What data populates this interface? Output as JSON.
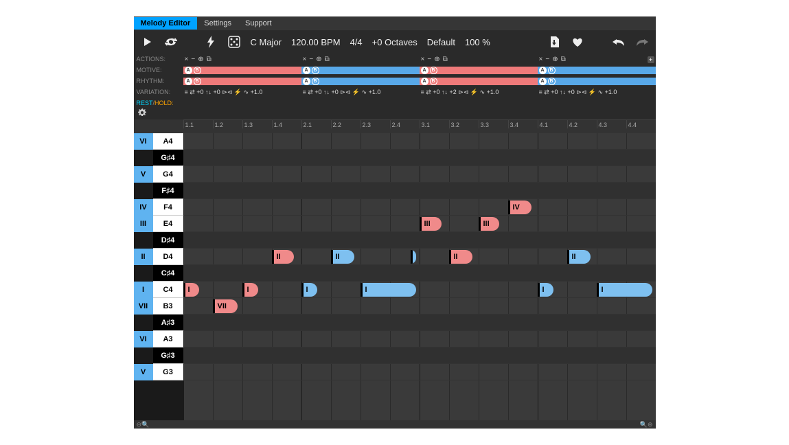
{
  "tabs": [
    "Melody Editor",
    "Settings",
    "Support"
  ],
  "active_tab": 0,
  "toolbar": {
    "key": "C Major",
    "bpm": "120.00 BPM",
    "time_sig": "4/4",
    "octaves": "+0 Octaves",
    "preset": "Default",
    "zoom": "100 %"
  },
  "section_rows": {
    "actions_label": "ACTIONS:",
    "motive_label": "MOTIVE:",
    "rhythm_label": "RHYTHM:",
    "variation_label": "VARIATION:",
    "rest_hold_label_rest": "REST",
    "rest_hold_label_hold": "HOLD:"
  },
  "sections": [
    {
      "color": "red",
      "motive": [
        "A",
        "B"
      ],
      "rhythm": [
        "A",
        "B"
      ],
      "variation": "≡ ⇄ +0   ↑↓ +0  ⊳⊲ ⚡ ∿ +1.0"
    },
    {
      "color": "blue",
      "motive": [
        "A",
        "B"
      ],
      "rhythm": [
        "A",
        "B"
      ],
      "variation": "≡ ⇄ +0   ↑↓ +0  ⊳⊲ ⚡ ∿ +1.0"
    },
    {
      "color": "red",
      "motive": [
        "A",
        "B"
      ],
      "rhythm": [
        "A",
        "B"
      ],
      "variation": "≡ ⇄ +0   ↑↓ +2  ⊳⊲ ⚡ ∿ +1.0"
    },
    {
      "color": "blue",
      "motive": [
        "A",
        "B"
      ],
      "rhythm": [
        "A",
        "B"
      ],
      "variation": "≡ ⇄ +0   ↑↓ +0  ⊳⊲ ⚡ ∿ +1.0"
    }
  ],
  "action_icons": [
    "×",
    "−",
    "⊕",
    "⧉"
  ],
  "beats": [
    "1.1",
    "1.2",
    "1.3",
    "1.4",
    "2.1",
    "2.2",
    "2.3",
    "2.4",
    "3.1",
    "3.2",
    "3.3",
    "3.4",
    "4.1",
    "4.2",
    "4.3",
    "4.4"
  ],
  "rows": [
    {
      "degree": "VI",
      "note": "A4",
      "black": false
    },
    {
      "degree": "",
      "note": "G♯4",
      "black": true
    },
    {
      "degree": "V",
      "note": "G4",
      "black": false
    },
    {
      "degree": "",
      "note": "F♯4",
      "black": true
    },
    {
      "degree": "IV",
      "note": "F4",
      "black": false
    },
    {
      "degree": "III",
      "note": "E4",
      "black": false
    },
    {
      "degree": "",
      "note": "D♯4",
      "black": true
    },
    {
      "degree": "II",
      "note": "D4",
      "black": false
    },
    {
      "degree": "",
      "note": "C♯4",
      "black": true
    },
    {
      "degree": "I",
      "note": "C4",
      "black": false
    },
    {
      "degree": "VII",
      "note": "B3",
      "black": false
    },
    {
      "degree": "",
      "note": "A♯3",
      "black": true
    },
    {
      "degree": "VI",
      "note": "A3",
      "black": false
    },
    {
      "degree": "",
      "note": "G♯3",
      "black": true
    },
    {
      "degree": "V",
      "note": "G3",
      "black": false
    }
  ],
  "notes": [
    {
      "row": 9,
      "start": 0.0,
      "len": 0.55,
      "label": "I",
      "color": "red"
    },
    {
      "row": 10,
      "start": 1.0,
      "len": 0.85,
      "label": "VII",
      "color": "red"
    },
    {
      "row": 9,
      "start": 2.0,
      "len": 0.55,
      "label": "I",
      "color": "red"
    },
    {
      "row": 7,
      "start": 3.0,
      "len": 0.75,
      "label": "II",
      "color": "red"
    },
    {
      "row": 9,
      "start": 4.0,
      "len": 0.55,
      "label": "I",
      "color": "blue"
    },
    {
      "row": 7,
      "start": 5.0,
      "len": 0.8,
      "label": "II",
      "color": "blue"
    },
    {
      "row": 9,
      "start": 6.0,
      "len": 1.9,
      "label": "I",
      "color": "blue"
    },
    {
      "row": 7,
      "start": 7.7,
      "len": 0.2,
      "label": "",
      "color": "blue"
    },
    {
      "row": 5,
      "start": 8.0,
      "len": 0.75,
      "label": "III",
      "color": "red"
    },
    {
      "row": 7,
      "start": 9.0,
      "len": 0.8,
      "label": "II",
      "color": "red"
    },
    {
      "row": 5,
      "start": 10.0,
      "len": 0.7,
      "label": "III",
      "color": "red"
    },
    {
      "row": 4,
      "start": 11.0,
      "len": 0.8,
      "label": "IV",
      "color": "red"
    },
    {
      "row": 9,
      "start": 12.0,
      "len": 0.55,
      "label": "I",
      "color": "blue"
    },
    {
      "row": 7,
      "start": 13.0,
      "len": 0.8,
      "label": "II",
      "color": "blue"
    },
    {
      "row": 9,
      "start": 14.0,
      "len": 1.9,
      "label": "I",
      "color": "blue"
    }
  ],
  "total_beats": 16
}
